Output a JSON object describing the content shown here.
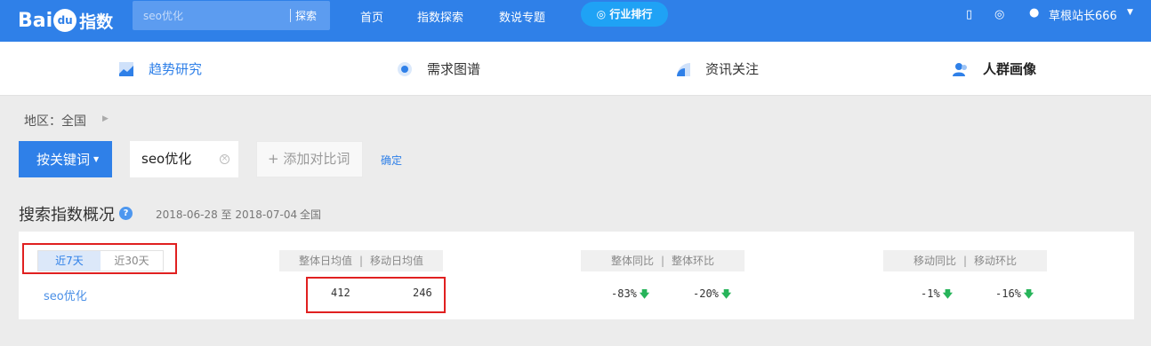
{
  "header": {
    "logo_text_left": "Bai",
    "logo_paw": "du",
    "logo_text_right": "指数",
    "search": {
      "value": "",
      "placeholder": "seo优化",
      "button": "探索"
    },
    "nav": [
      "首页",
      "指数探索",
      "数说专题"
    ],
    "rank_pill": "行业排行",
    "user": "草根站长666"
  },
  "tabs": [
    {
      "label": "趋势研究",
      "icon": "trend-icon",
      "active": true
    },
    {
      "label": "需求图谱",
      "icon": "demand-graph-icon",
      "active": false
    },
    {
      "label": "资讯关注",
      "icon": "news-icon",
      "active": false
    },
    {
      "label": "人群画像",
      "icon": "crowd-icon",
      "active": false,
      "bold": true
    }
  ],
  "region": {
    "label": "地区：全国"
  },
  "keyword": {
    "mode_button": "按关键词",
    "chip": "seo优化",
    "add_button": "+ 添加对比词",
    "confirm": "确定"
  },
  "overview": {
    "title": "搜索指数概况",
    "date_range": "2018-06-28 至 2018-07-04",
    "scope": "全国",
    "range_options": [
      "近7天",
      "近30天"
    ],
    "selected_range": "近7天",
    "headers": {
      "avg": [
        "整体日均值",
        "移动日均值"
      ],
      "yoy_overall": [
        "整体同比",
        "整体环比"
      ],
      "yoy_mobile": [
        "移动同比",
        "移动环比"
      ]
    },
    "row": {
      "keyword": "seo优化",
      "overall_avg": "412",
      "mobile_avg": "246",
      "overall_yoy": "-83%",
      "overall_mom": "-20%",
      "mobile_yoy": "-1%",
      "mobile_mom": "-16%"
    }
  },
  "colors": {
    "brand": "#2f80e8",
    "highlight": "#e02020",
    "down_arrow": "#27b45a"
  }
}
